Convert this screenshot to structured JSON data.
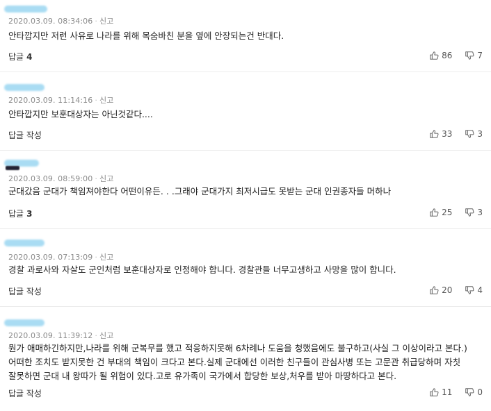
{
  "report_label": "신고",
  "comments": [
    {
      "timestamp": "2020.03.09. 08:34:06",
      "text": [
        "안타깝지만 저런 사유로 나라를 위해 목숨바친 분을 옆에 안장되는건 반대다."
      ],
      "reply_label": "답글",
      "reply_count": "4",
      "likes": "86",
      "dislikes": "7"
    },
    {
      "timestamp": "2020.03.09. 11:14:16",
      "text": [
        "안타깝지만 보훈대상자는 아닌것같다...."
      ],
      "reply_label": "답글 작성",
      "reply_count": "",
      "likes": "33",
      "dislikes": "3"
    },
    {
      "timestamp": "2020.03.09. 08:59:00",
      "text": [
        "군대갔음 군대가 책임져야한다 어떤이유든. . .그래야 군대가지 최저시급도 못받는 군대 인권종자들 머하나"
      ],
      "reply_label": "답글",
      "reply_count": "3",
      "likes": "25",
      "dislikes": "3"
    },
    {
      "timestamp": "2020.03.09. 07:13:09",
      "text": [
        "경찰 과로사와 자살도 군인처럼 보훈대상자로 인정해야 합니다. 경찰관들 너무고생하고 사망을 많이 합니다."
      ],
      "reply_label": "답글 작성",
      "reply_count": "",
      "likes": "20",
      "dislikes": "4"
    },
    {
      "timestamp": "2020.03.09. 11:39:12",
      "text": [
        "뭔가 애매하긴하지만,나라를 위해 군복무를 했고 적응하지못해 6차례나 도움을 청했음에도 불구하고(사실 그 이상이라고 본다.)",
        "어떠한 조치도 받지못한 건 부대의 책임이 크다고 본다.실제 군대에선 이러한 친구들이 관심사병 또는 고문관 취급당하며 자칫",
        "잘못하면 군대 내 왕따가 될 위험이 있다.고로 유가족이 국가에서 합당한 보상,처우를 받아 마땅하다고 본다."
      ],
      "reply_label": "답글 작성",
      "reply_count": "",
      "likes": "11",
      "dislikes": "0"
    }
  ]
}
